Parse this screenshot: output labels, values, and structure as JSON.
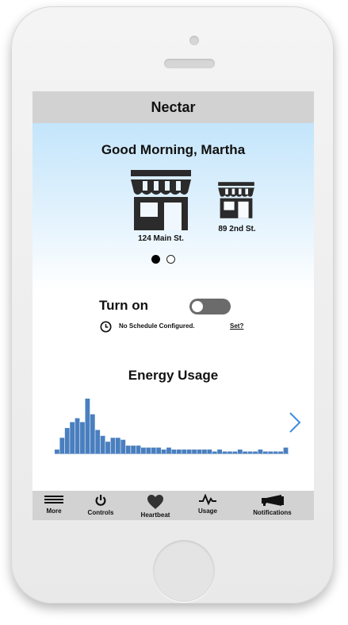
{
  "app": {
    "title": "Nectar"
  },
  "greeting": "Good Morning, Martha",
  "stores": [
    {
      "label": "124 Main St.",
      "icon": "store-icon"
    },
    {
      "label": "89 2nd St.",
      "icon": "store-icon"
    }
  ],
  "pager": {
    "count": 2,
    "active": 0
  },
  "power": {
    "label": "Turn on",
    "on": false
  },
  "schedule": {
    "text": "No Schedule Configured.",
    "link": "Set?",
    "icon": "clock-icon"
  },
  "energy": {
    "title": "Energy Usage"
  },
  "chart_data": {
    "type": "bar",
    "title": "Energy Usage",
    "xlabel": "",
    "ylabel": "",
    "values": [
      2,
      8,
      13,
      16,
      18,
      16,
      28,
      20,
      12,
      9,
      6,
      8,
      8,
      7,
      4,
      4,
      4,
      3,
      3,
      3,
      3,
      2,
      3,
      2,
      2,
      2,
      2,
      2,
      2,
      2,
      2,
      1,
      2,
      1,
      1,
      1,
      2,
      1,
      1,
      1,
      2,
      1,
      1,
      1,
      1,
      3
    ],
    "ylim": [
      0,
      30
    ],
    "bar_color": "#4a7fbf"
  },
  "tabs": [
    {
      "label": "More",
      "icon": "menu-icon"
    },
    {
      "label": "Controls",
      "icon": "power-icon"
    },
    {
      "label": "Heartbeat",
      "icon": "heart-icon"
    },
    {
      "label": "Usage",
      "icon": "pulse-icon"
    },
    {
      "label": "Notifications",
      "icon": "megaphone-icon"
    }
  ],
  "colors": {
    "titlebar": "#d2d2d2",
    "hero_top": "#c4e5fb",
    "chevron": "#3b8de0",
    "toggle_off": "#6b6b6b"
  }
}
